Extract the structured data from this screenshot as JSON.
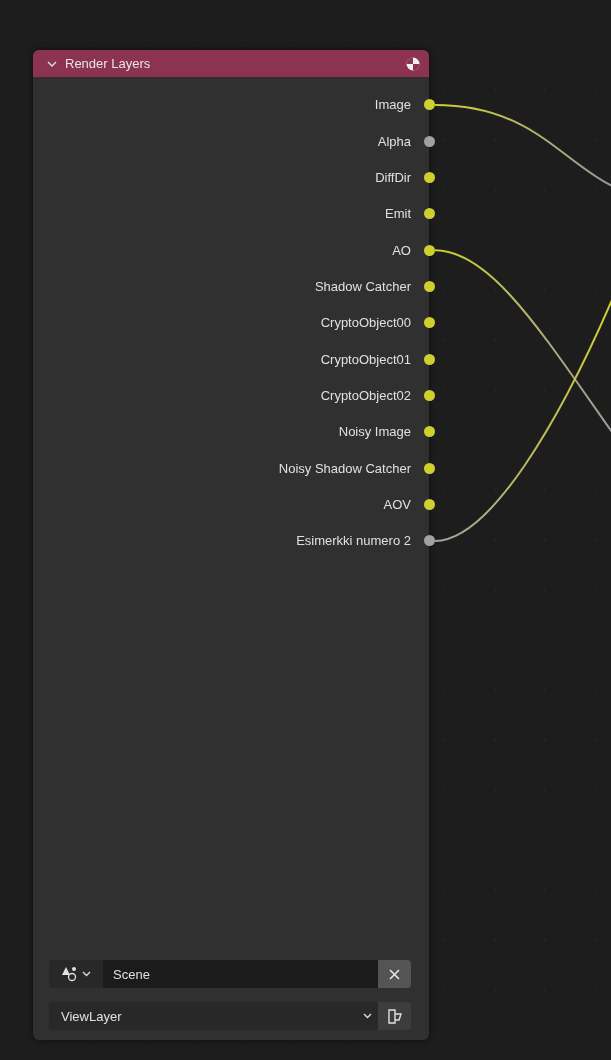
{
  "node": {
    "title": "Render Layers",
    "expanded": true,
    "outputs": [
      {
        "label": "Image",
        "color": "#cfcf2e"
      },
      {
        "label": "Alpha",
        "color": "#a1a1a1"
      },
      {
        "label": "DiffDir",
        "color": "#cfcf2e"
      },
      {
        "label": "Emit",
        "color": "#cfcf2e"
      },
      {
        "label": "AO",
        "color": "#cfcf2e"
      },
      {
        "label": "Shadow Catcher",
        "color": "#cfcf2e"
      },
      {
        "label": "CryptoObject00",
        "color": "#cfcf2e"
      },
      {
        "label": "CryptoObject01",
        "color": "#cfcf2e"
      },
      {
        "label": "CryptoObject02",
        "color": "#cfcf2e"
      },
      {
        "label": "Noisy Image",
        "color": "#cfcf2e"
      },
      {
        "label": "Noisy Shadow Catcher",
        "color": "#cfcf2e"
      },
      {
        "label": "AOV",
        "color": "#cfcf2e"
      },
      {
        "label": "Esimerkki numero 2",
        "color": "#a1a1a1"
      }
    ],
    "scene": {
      "value": "Scene"
    },
    "view_layer": {
      "value": "ViewLayer"
    }
  }
}
